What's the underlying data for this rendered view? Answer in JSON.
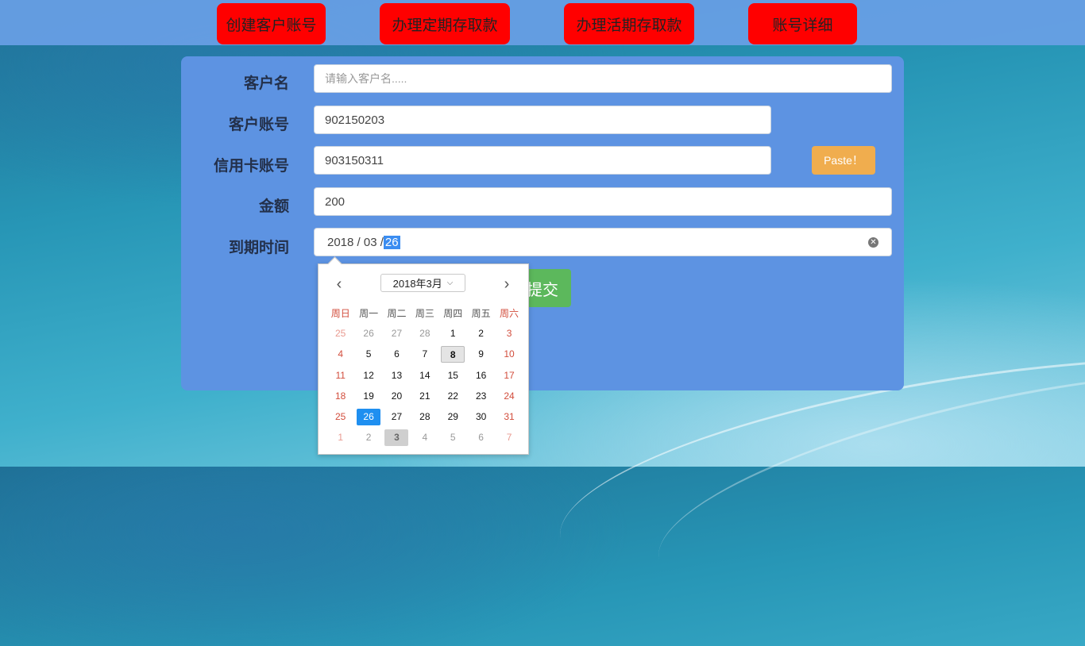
{
  "nav": [
    {
      "label": "创建客户账号"
    },
    {
      "label": "办理定期存取款"
    },
    {
      "label": "办理活期存取款"
    },
    {
      "label": "账号详细"
    }
  ],
  "form": {
    "customer_name_label": "客户名",
    "customer_name_placeholder": "请输入客户名.....",
    "account_label": "客户账号",
    "account_value": "902150203",
    "card_label": "信用卡账号",
    "card_value": "903150311",
    "paste_label": "Paste！",
    "amount_label": "金额",
    "amount_value": "200",
    "expiry_label": "到期时间",
    "expiry_year": "2018",
    "expiry_month": "03",
    "expiry_day": "26",
    "submit_label": "提交"
  },
  "calendar": {
    "month_label": "2018年3月",
    "weekdays": [
      "周日",
      "周一",
      "周二",
      "周三",
      "周四",
      "周五",
      "周六"
    ],
    "weeks": [
      [
        "25",
        "26",
        "27",
        "28",
        "1",
        "2",
        "3"
      ],
      [
        "4",
        "5",
        "6",
        "7",
        "8",
        "9",
        "10"
      ],
      [
        "11",
        "12",
        "13",
        "14",
        "15",
        "16",
        "17"
      ],
      [
        "18",
        "19",
        "20",
        "21",
        "22",
        "23",
        "24"
      ],
      [
        "25",
        "26",
        "27",
        "28",
        "29",
        "30",
        "31"
      ],
      [
        "1",
        "2",
        "3",
        "4",
        "5",
        "6",
        "7"
      ]
    ],
    "selected_day": "26",
    "highlighted_day": "8"
  },
  "colors": {
    "nav_button": "#ff0000",
    "panel": "#5d93e2",
    "paste": "#f0ad4e",
    "submit": "#5cb85c",
    "selected": "#1f8ff0"
  }
}
